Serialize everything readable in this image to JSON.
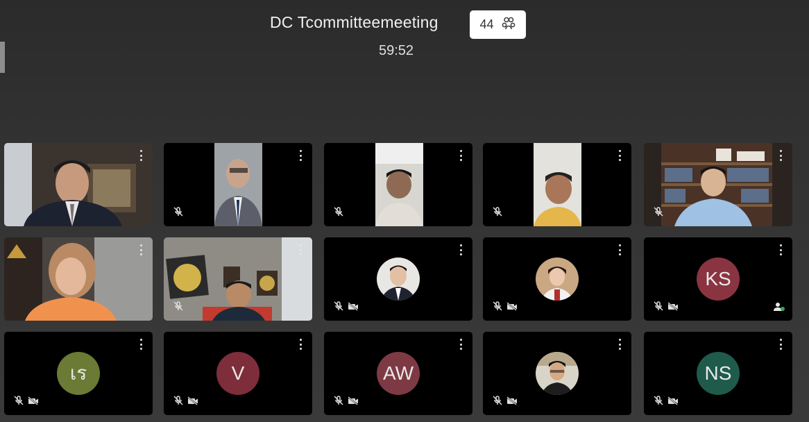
{
  "meeting": {
    "title": "DC Tcommitteemeeting",
    "timer": "59:52"
  },
  "participants": {
    "count": "44",
    "icon": "people-group-icon"
  },
  "colors": {
    "avatar_ks": "#8b3441",
    "avatar_re": "#6b7a34",
    "avatar_v": "#7e2e3a",
    "avatar_aw": "#7e3a44",
    "avatar_ns": "#1f5b4a"
  },
  "tiles": {
    "r3c1": {
      "initials": "เร"
    },
    "r2c5": {
      "initials": "KS"
    },
    "r3c2": {
      "initials": "V"
    },
    "r3c3": {
      "initials": "AW"
    },
    "r3c5": {
      "initials": "NS"
    }
  }
}
